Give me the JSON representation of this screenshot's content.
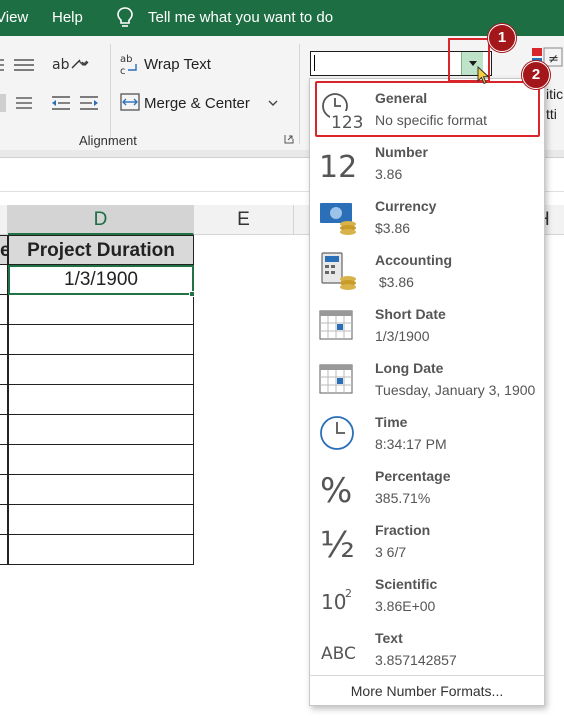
{
  "menu": {
    "view": "View",
    "help": "Help",
    "tell_me": "Tell me what you want to do"
  },
  "ribbon": {
    "wrap_text": "Wrap Text",
    "merge_center": "Merge & Center",
    "alignment_label": "Alignment",
    "number_format_value": "",
    "partial_right_1": "itic",
    "partial_right_2": "tti"
  },
  "sheet": {
    "columns": [
      {
        "label": "D",
        "selected": true
      },
      {
        "label": "E",
        "selected": false
      },
      {
        "label": "H",
        "selected": false
      }
    ],
    "header_cell": "Project Duration",
    "header_prefix": "e",
    "rows": [
      "1/3/1900",
      "",
      "",
      "",
      "",
      "",
      "",
      "",
      "",
      ""
    ]
  },
  "dropdown": {
    "options": [
      {
        "name": "General",
        "example": "No specific format",
        "icon": "clock-123-icon"
      },
      {
        "name": "Number",
        "example": "3.86",
        "icon": "number-12-icon"
      },
      {
        "name": "Currency",
        "example": "$3.86",
        "icon": "currency-icon"
      },
      {
        "name": "Accounting",
        "example": " $3.86",
        "icon": "accounting-icon"
      },
      {
        "name": "Short Date",
        "example": "1/3/1900",
        "icon": "calendar-icon"
      },
      {
        "name": "Long Date",
        "example": "Tuesday, January 3, 1900",
        "icon": "calendar-icon"
      },
      {
        "name": "Time",
        "example": "8:34:17 PM",
        "icon": "clock-icon"
      },
      {
        "name": "Percentage",
        "example": "385.71%",
        "icon": "percent-icon"
      },
      {
        "name": "Fraction",
        "example": "3 6/7",
        "icon": "fraction-icon"
      },
      {
        "name": "Scientific",
        "example": "3.86E+00",
        "icon": "scientific-icon"
      },
      {
        "name": "Text",
        "example": "3.857142857",
        "icon": "text-abc-icon"
      }
    ],
    "more_label": "More Number Formats...",
    "icon_glyphs": {
      "number": "12",
      "percent": "%",
      "fraction": "½",
      "sci_base": "10",
      "sci_exp": "2",
      "text": "ABC",
      "general_digits": "123"
    }
  },
  "badges": [
    "1",
    "2"
  ],
  "colors": {
    "menubar": "#1e6e43",
    "highlight": "#d9262c",
    "badge": "#a3171b",
    "selected_col": "#217346"
  }
}
